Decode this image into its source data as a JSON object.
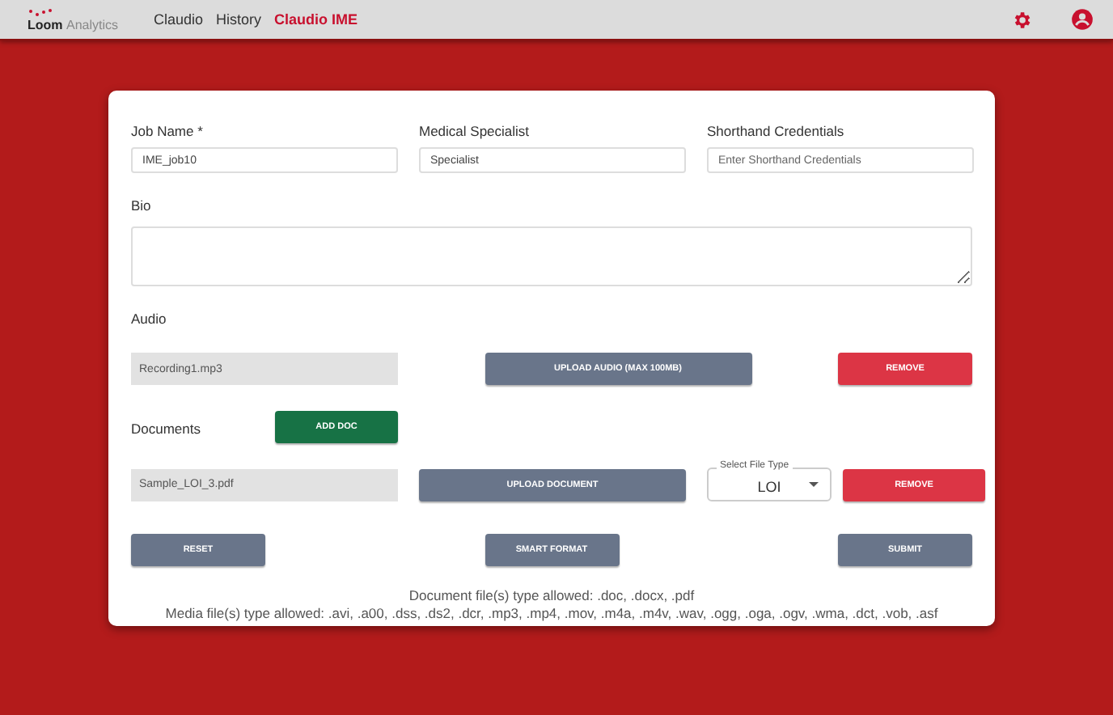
{
  "header": {
    "logo": {
      "brand": "Loom",
      "suffix": "Analytics"
    },
    "nav": [
      {
        "label": "Claudio",
        "selected": false
      },
      {
        "label": "History",
        "selected": false
      },
      {
        "label": "Claudio IME",
        "selected": true
      }
    ]
  },
  "form": {
    "fields": [
      {
        "label": "Job Name *",
        "value": "IME_job10"
      },
      {
        "label": "Medical Specialist",
        "value": "Specialist"
      },
      {
        "label": "Shorthand Credentials",
        "placeholder": "Enter Shorthand Credentials"
      }
    ],
    "bio": {
      "label": "Bio"
    },
    "audio": {
      "label": "Audio",
      "file": "Recording1.mp3",
      "upload": "UPLOAD AUDIO (MAX 100MB)",
      "remove": "REMOVE"
    },
    "documents": {
      "label": "Documents",
      "add": "ADD DOC",
      "file": "Sample_LOI_3.pdf",
      "upload": "UPLOAD DOCUMENT",
      "type_label": "Select File Type",
      "type_value": "LOI",
      "remove": "REMOVE"
    },
    "actions": [
      "RESET",
      "SMART FORMAT",
      "SUBMIT"
    ],
    "notes": [
      "Document file(s) type allowed: .doc, .docx, .pdf",
      "Media file(s) type allowed: .avi, .a00, .dss, .ds2, .dcr, .mp3, .mp4, .mov, .m4a, .m4v, .wav, .ogg, .oga, .ogv, .wma, .dct, .vob, .asf"
    ]
  }
}
